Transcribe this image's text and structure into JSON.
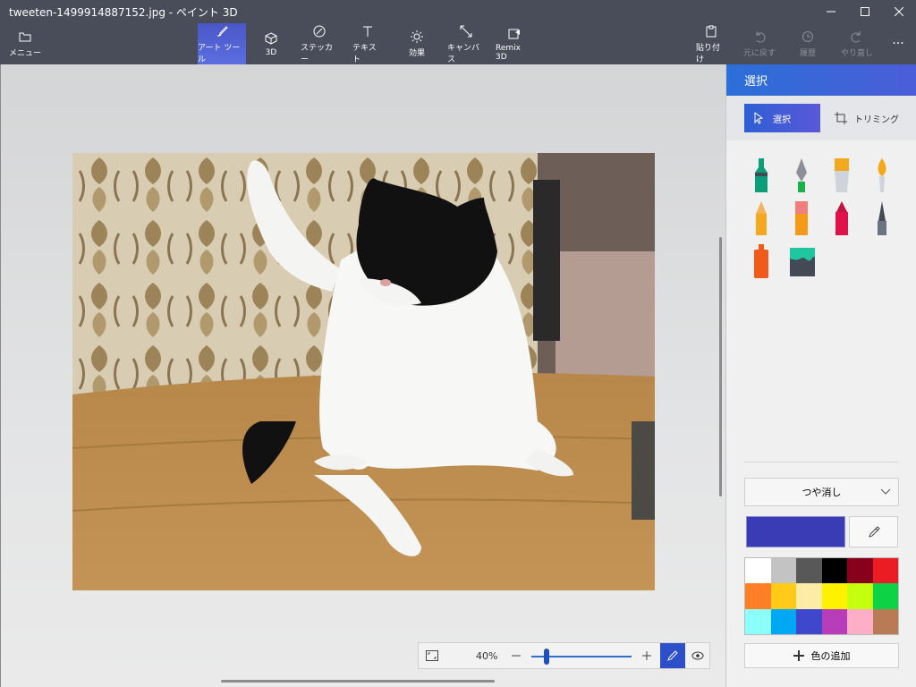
{
  "window": {
    "title": "tweeten-1499914887152.jpg - ペイント 3D",
    "minimize_icon": "minimize-icon",
    "maximize_icon": "maximize-icon",
    "close_icon": "close-icon"
  },
  "toolbar": {
    "menu": "メニュー",
    "art_tools": "アート ツール",
    "three_d": "3D",
    "stickers": "ステッカー",
    "text": "テキスト",
    "effects": "効果",
    "canvas": "キャンバス",
    "remix": "Remix 3D",
    "paste": "貼り付け",
    "undo": "元に戻す",
    "history": "履歴",
    "redo": "やり直し",
    "more": "···"
  },
  "zoom": {
    "level": "40%",
    "slider_value": 0.15
  },
  "panel": {
    "title": "選択",
    "tab_select": "選択",
    "tab_crop": "トリミング",
    "finish_dropdown": "つや消し",
    "add_color": "色の追加",
    "current_color": "#3a3cb5",
    "palette": [
      "#ffffff",
      "#c3c3c3",
      "#585858",
      "#000000",
      "#88001b",
      "#ec1c24",
      "#ff7f27",
      "#ffca18",
      "#fdeca6",
      "#fff200",
      "#c4ff0e",
      "#0ed145",
      "#8cfffb",
      "#00a8f3",
      "#3f48cc",
      "#b83dba",
      "#ffaec8",
      "#b97a56"
    ],
    "brushes": [
      "marker-icon",
      "calligraphy-pen-icon",
      "oil-brush-icon",
      "watercolor-icon",
      "pencil-icon",
      "eraser-icon",
      "crayon-icon",
      "pixel-pen-icon",
      "spray-can-icon",
      "fill-bucket-icon"
    ]
  }
}
